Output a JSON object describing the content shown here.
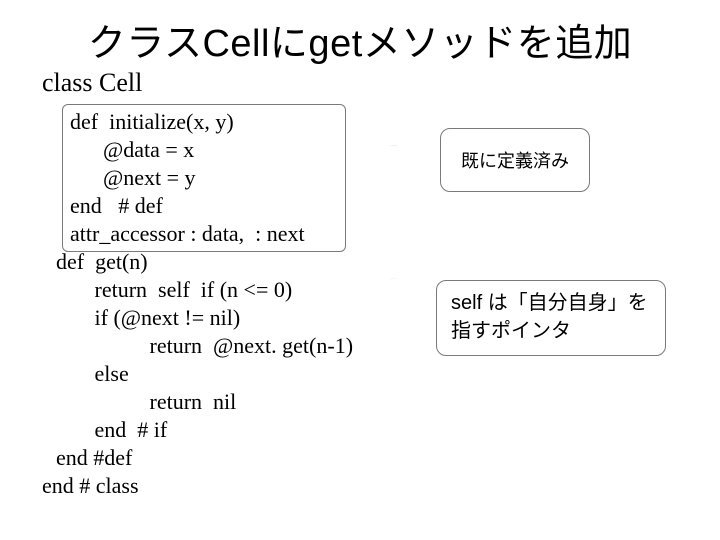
{
  "title": "クラスCellにgetメソッドを追加",
  "class_decl": "class  Cell",
  "code_lines": {
    "l0": "def  initialize(x, y)",
    "l1": "      @data = x",
    "l2": "      @next = y",
    "l3": "end   # def",
    "l4": "attr_accessor : data,  : next",
    "l5": "def  get(n)",
    "l6": "       return  self  if (n <= 0)",
    "l7": "       if (@next != nil)",
    "l8": "                 return  @next. get(n-1)",
    "l9": "       else",
    "l10": "                 return  nil",
    "l11": "       end  # if",
    "l12": "end #def",
    "l13": "end # class"
  },
  "callout1_text": "既に定義済み",
  "callout2_self": "self ",
  "callout2_rest1": "は「自分自身」を",
  "callout2_rest2": "指すポインタ"
}
